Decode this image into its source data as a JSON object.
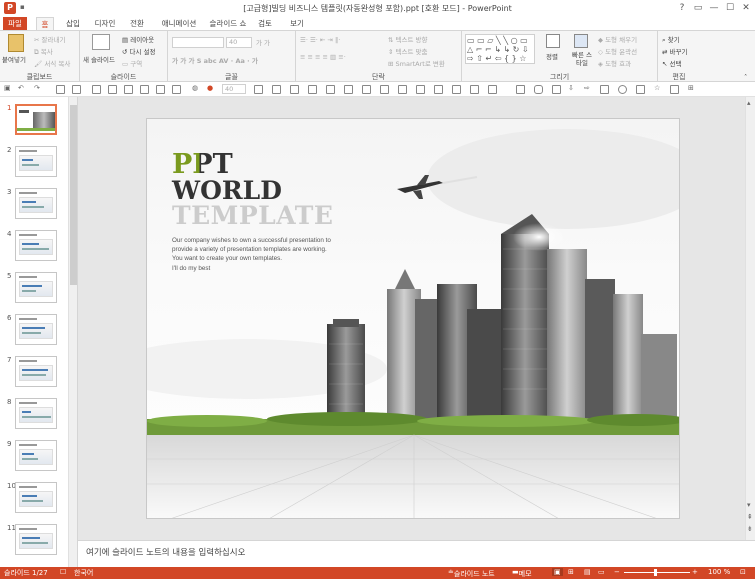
{
  "window": {
    "title": "[고급형]빌딩 비즈니스 템플릿(자동완성형 포함).ppt [호환 모드] - PowerPoint",
    "app_letter": "P",
    "controls": [
      "?",
      "▭",
      "—",
      "☐",
      "✕"
    ]
  },
  "tabs": [
    {
      "label": "파일"
    },
    {
      "label": "홈"
    },
    {
      "label": "삽입"
    },
    {
      "label": "디자인"
    },
    {
      "label": "전환"
    },
    {
      "label": "애니메이션"
    },
    {
      "label": "슬라이드 쇼"
    },
    {
      "label": "검토"
    },
    {
      "label": "보기"
    }
  ],
  "ribbon": {
    "clipboard": {
      "label": "클립보드",
      "paste": "붙여넣기",
      "cut": "잘라내기",
      "copy": "복사",
      "format_painter": "서식 복사"
    },
    "slides": {
      "label": "슬라이드",
      "new_slide": "새 슬라이드",
      "layout": "레이아웃",
      "reset": "다시 설정",
      "section": "구역"
    },
    "font": {
      "label": "글꼴",
      "size": "40"
    },
    "paragraph": {
      "label": "단락",
      "text_direction": "텍스트 방향",
      "align_text": "텍스트 맞춤",
      "smartart": "SmartArt로 변환"
    },
    "drawing": {
      "label": "그리기",
      "arrange": "정렬",
      "quick_styles": "빠른 스타일",
      "shape_fill": "도형 채우기",
      "shape_outline": "도형 윤곽선",
      "shape_effects": "도형 효과"
    },
    "editing": {
      "label": "편집",
      "find": "찾기",
      "replace": "바꾸기",
      "select": "선택"
    }
  },
  "qat": {
    "font_size": "40"
  },
  "thumbnails": [
    {
      "num": "1"
    },
    {
      "num": "2"
    },
    {
      "num": "3"
    },
    {
      "num": "4"
    },
    {
      "num": "5"
    },
    {
      "num": "6"
    },
    {
      "num": "7"
    },
    {
      "num": "8"
    },
    {
      "num": "9"
    },
    {
      "num": "10"
    },
    {
      "num": "11"
    }
  ],
  "slide": {
    "ppt": "PPT",
    "world": "WORLD",
    "template": "TEMPLATE",
    "desc1": "Our company wishes to own a successful presentation to",
    "desc2": "provide a variety of presentation templates are working.",
    "desc3": "You want to create your own templates.",
    "desc4": "I'll do my best"
  },
  "notes_placeholder": "여기에 슬라이드 노트의 내용을 입력하십시오",
  "status": {
    "slide_of": "슬라이드 1/27",
    "language": "한국어",
    "notes": "슬라이드 노트",
    "comments": "메모",
    "zoom": "100 %"
  },
  "colors": {
    "accent": "#d24726",
    "ppt_green": "#7a9a1e"
  }
}
